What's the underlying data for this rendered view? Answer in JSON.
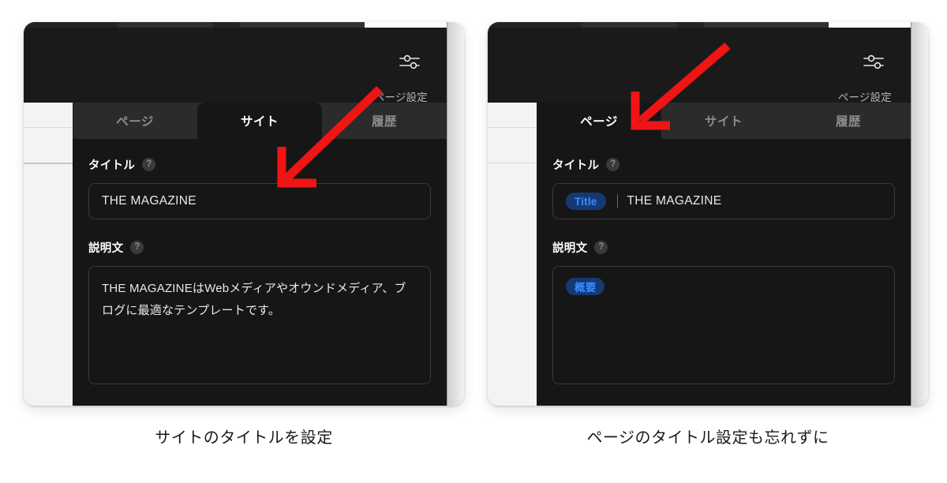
{
  "figure": {
    "background_color": "#ffffff",
    "annotation_color": "#f01414"
  },
  "panels": [
    {
      "id": "site-settings",
      "toolbar": {
        "tuner_icon": "sliders-icon",
        "page_settings_label": "ページ設定"
      },
      "tabs": [
        {
          "label": "ページ",
          "active": false
        },
        {
          "label": "サイト",
          "active": true
        },
        {
          "label": "履歴",
          "active": false
        }
      ],
      "fields": {
        "title": {
          "label": "タイトル",
          "help_icon": "?",
          "chip": null,
          "value": "THE MAGAZINE"
        },
        "description": {
          "label": "説明文",
          "help_icon": "?",
          "chip": null,
          "value": "THE MAGAZINEはWebメディアやオウンドメディア、ブログに最適なテンプレートです。"
        }
      },
      "annotation_arrow": "down-left-arrow",
      "caption": "サイトのタイトルを設定"
    },
    {
      "id": "page-settings",
      "toolbar": {
        "tuner_icon": "sliders-icon",
        "page_settings_label": "ページ設定"
      },
      "tabs": [
        {
          "label": "ページ",
          "active": true
        },
        {
          "label": "サイト",
          "active": false
        },
        {
          "label": "履歴",
          "active": false
        }
      ],
      "fields": {
        "title": {
          "label": "タイトル",
          "help_icon": "?",
          "chip": "Title",
          "value": "THE MAGAZINE"
        },
        "description": {
          "label": "説明文",
          "help_icon": "?",
          "chip": "概要",
          "value": ""
        }
      },
      "annotation_arrow": "down-left-arrow",
      "caption": "ページのタイトル設定も忘れずに"
    }
  ]
}
